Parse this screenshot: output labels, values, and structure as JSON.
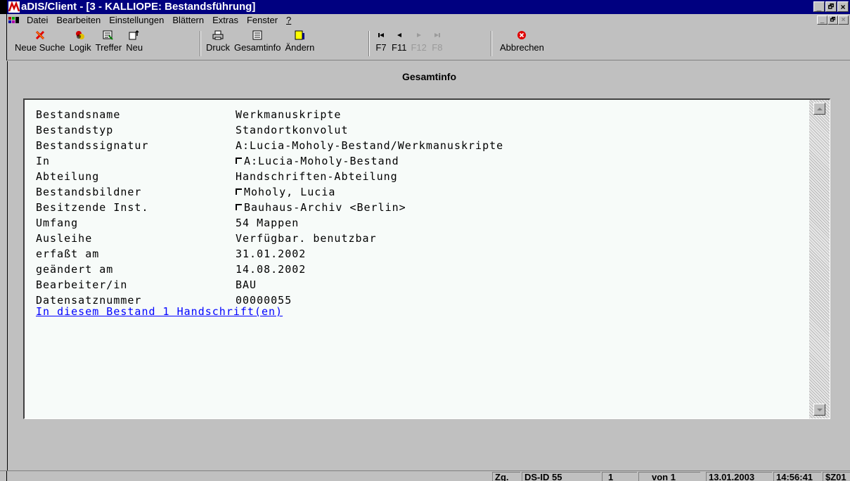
{
  "window": {
    "title": "aDIS/Client - [3 - KALLIOPE: Bestandsführung]",
    "controls": [
      "_",
      "🗗",
      "×"
    ]
  },
  "menu": {
    "items": [
      "Datei",
      "Bearbeiten",
      "Einstellungen",
      "Blättern",
      "Extras",
      "Fenster",
      "?"
    ],
    "mdi_controls": [
      "_",
      "🗗",
      "×"
    ]
  },
  "toolbar": {
    "buttons": [
      {
        "label": "Neue Suche",
        "icon": "x-mark-icon"
      },
      {
        "label": "Logik",
        "icon": "logic-circles-icon"
      },
      {
        "label": "Treffer",
        "icon": "hits-icon"
      },
      {
        "label": "Neu",
        "icon": "new-document-icon"
      },
      {
        "label": "Druck",
        "icon": "printer-icon"
      },
      {
        "label": "Gesamtinfo",
        "icon": "info-document-icon"
      },
      {
        "label": "Ändern",
        "icon": "edit-icon"
      },
      {
        "label": "F7",
        "icon": "first-record-icon"
      },
      {
        "label": "F11",
        "icon": "previous-record-icon"
      },
      {
        "label": "F12",
        "icon": "next-record-icon",
        "disabled": true
      },
      {
        "label": "F8",
        "icon": "last-record-icon",
        "disabled": true
      },
      {
        "label": "Abbrechen",
        "icon": "cancel-icon"
      }
    ]
  },
  "page": {
    "title": "Gesamtinfo"
  },
  "record": {
    "fields": [
      {
        "label": "Bestandsname",
        "value": "Werkmanuskripte",
        "checkbox": false
      },
      {
        "label": "Bestandstyp",
        "value": "Standortkonvolut",
        "checkbox": false
      },
      {
        "label": "Bestandssignatur",
        "value": "A:Lucia-Moholy-Bestand/Werkmanuskripte",
        "checkbox": false
      },
      {
        "label": "In",
        "value": "A:Lucia-Moholy-Bestand",
        "checkbox": true
      },
      {
        "label": "Abteilung",
        "value": "Handschriften-Abteilung",
        "checkbox": false
      },
      {
        "label": "Bestandsbildner",
        "value": "Moholy, Lucia",
        "checkbox": true
      },
      {
        "label": "Besitzende Inst.",
        "value": "Bauhaus-Archiv <Berlin>",
        "checkbox": true
      },
      {
        "label": "Umfang",
        "value": "54 Mappen",
        "checkbox": false
      },
      {
        "label": "Ausleihe",
        "value": "Verfügbar. benutzbar",
        "checkbox": false
      },
      {
        "label": "erfaßt am",
        "value": "31.01.2002",
        "checkbox": false
      },
      {
        "label": "geändert am",
        "value": "14.08.2002",
        "checkbox": false
      },
      {
        "label": "Bearbeiter/in",
        "value": "BAU",
        "checkbox": false
      },
      {
        "label": "Datensatznummer",
        "value": "00000055",
        "checkbox": false
      }
    ],
    "link": "In diesem Bestand 1 Handschrift(en)"
  },
  "status": {
    "zg": "Zg.",
    "ds_id": "DS-ID 55",
    "current": "1",
    "of": "von 1",
    "date": "13.01.2003",
    "time": "14:56:41",
    "code": "$Z01"
  },
  "colors": {
    "titlebar": "#000080",
    "chrome": "#c0c0c0",
    "content_bg": "#f7fbf9",
    "link": "#0000ff"
  }
}
